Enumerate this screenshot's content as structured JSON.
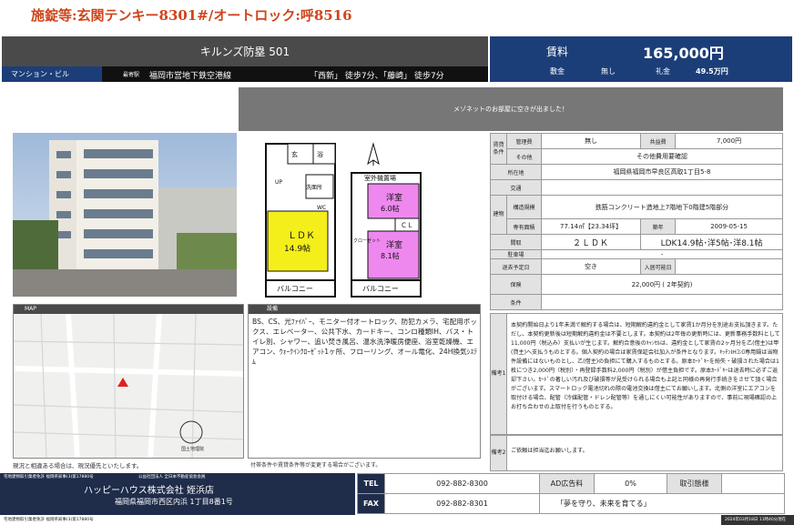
{
  "top_note": "施錠等:玄関テンキー8301#/オートロック:呼8516",
  "header": {
    "property_name": "キルンズ防塁 501",
    "type": "マンション・ビル",
    "line_label": "最寄駅",
    "line": "福岡市営地下鉄空港線",
    "stations": "「西新」 徒歩7分、「藤崎」 徒歩7分"
  },
  "price": {
    "rent_label": "賃料",
    "rent": "165,000円",
    "deposit_label": "敷金",
    "deposit": "無し",
    "key_money_label": "礼金",
    "key_money": "49.5万円"
  },
  "banner": "メゾネットのお部屋に空きが出ました！",
  "floorplan": {
    "ldk": "ＬＤＫ",
    "ldk_size": "14.9帖",
    "western1": "洋室",
    "western1_size": "6.0帖",
    "western2": "洋室",
    "western2_size": "8.1帖",
    "balcony": "バルコニー",
    "cl": "ＣＬ",
    "utility": "室外機置場",
    "closet": "クローゼット",
    "washroom": "洗面所",
    "bath": "浴",
    "wc": "WC",
    "up": "UP",
    "entrance": "玄"
  },
  "map": {
    "label": "MAP",
    "note": "現況と相違ある場合は、現況優先といたします。",
    "scale": "国土地理院"
  },
  "equipment": {
    "label": "設備",
    "text": "BS、CS、光ﾌｧｲﾊﾞｰ、モニター付オートロック、防犯カメラ、宅配用ボックス、エレベーター、公共下水、カードキー、コンロ種類IH、バス・トイレ別、シャワー、追い焚き風呂、温水洗浄暖房便座、浴室乾燥機、エアコン、ｳｫｰｸｲﾝｸﾛｰｾﾞｯﾄ1ヶ所、フローリング、オール電化、24H換気ｼｽﾃﾑ",
    "note": "付帯条件や賃貸条件等が変更する場合がございます。"
  },
  "spec": {
    "cost_group": "賃貸条件",
    "mgmt_fee_label": "管理費",
    "mgmt_fee": "無し",
    "common_fee_label": "共益費",
    "common_fee": "7,000円",
    "other_label": "その他",
    "other": "その他費用要確認",
    "location_label": "所在地",
    "location": "福岡県福岡市早良区高取1丁目5-8",
    "transport_label": "交通",
    "transport": "",
    "building_group": "建物",
    "structure_label": "構造規模",
    "structure": "鉄筋コンクリート造地上7階地下0階建5階部分",
    "area_label": "専有面積",
    "area": "77.14㎡【23.34坪】",
    "built_label": "築年",
    "built": "2009-05-15",
    "layout_label": "間取",
    "layout": "２ＬＤＫ",
    "layout_detail": "LDK14.9帖･洋5帖･洋8.1帖",
    "parking_label": "駐車場",
    "parking": "-",
    "movein_label": "退去予定日",
    "movein": "空き",
    "movein_date_label": "入居可能日",
    "movein_date": "",
    "insurance_label": "保険",
    "insurance": "22,000円 ( 2年契約)",
    "conditions_label": "条件",
    "conditions": ""
  },
  "notes": {
    "label1": "備考1",
    "text1": "本契約開始日より1年未満で解約する場合は、短期解約違約金として家賃1か月分を別途お支払頂きます。ただし、本契約更新後は短期解約違約金は不要とします。本契約は2年毎の更新時には、更新事務手数料として11,000円（税込み）支払いが生じます。解約合意後のｷｬﾝｾﾙは、違約金として家賃の2ヶ月分を乙(借主)は甲(貸主)へ支払うものとする。個人契約の場合は家賃保証会社加入が条件となります。ｷｯﾁﾝIHｺﾝﾛ専用鍋は当物件設備にはないものとし、乙(借主)の負担にて購入するものとする。原本ｶｰﾄﾞｷｰを紛失・破損された場合は1枚につき2,000円（税別）・再登録手数料2,000円（税別）が借主負担です。原本ｶｰﾄﾞｷｰは退去時に必ずご返却下さい。ｶｰﾄﾞの著しい汚れ及び破損等が見受けられる場合も上記と同様の再発行手続きをさせて頂く場合がございます。スマートロック電池切れの際の電池交換は借主にてお願いします。北側の洋室にエアコンを取付ける場合、配管（冷媒配管・ドレン配管等）を通しにくい可能性がありますので、事前に現場確認の上お打ち合わせの上取付を行うものとする。",
    "label2": "備考2",
    "text2": "ご依頼は担当迄お願いします。"
  },
  "footer": {
    "license": "宅地建物取引業者免許 福岡県知事(3)第17880号",
    "association": "公益社団法人 全日本不動産協会会員",
    "company": "ハッピーハウス株式会社 姪浜店",
    "address": "福岡県福岡市西区内浜 1丁目8番1号",
    "tel_label": "TEL",
    "tel": "092-882-8300",
    "fax_label": "FAX",
    "fax": "092-882-8301",
    "ad_label": "AD広告料",
    "ad": "0%",
    "trade_label": "取引態様",
    "trade": "",
    "slogan": "「夢を守り、未来を育てる」"
  },
  "bottom": {
    "left": "宅地建物取引業者免許 福岡県知事(3)第17880号",
    "right": "2024年03月18日 11時40分現在"
  }
}
